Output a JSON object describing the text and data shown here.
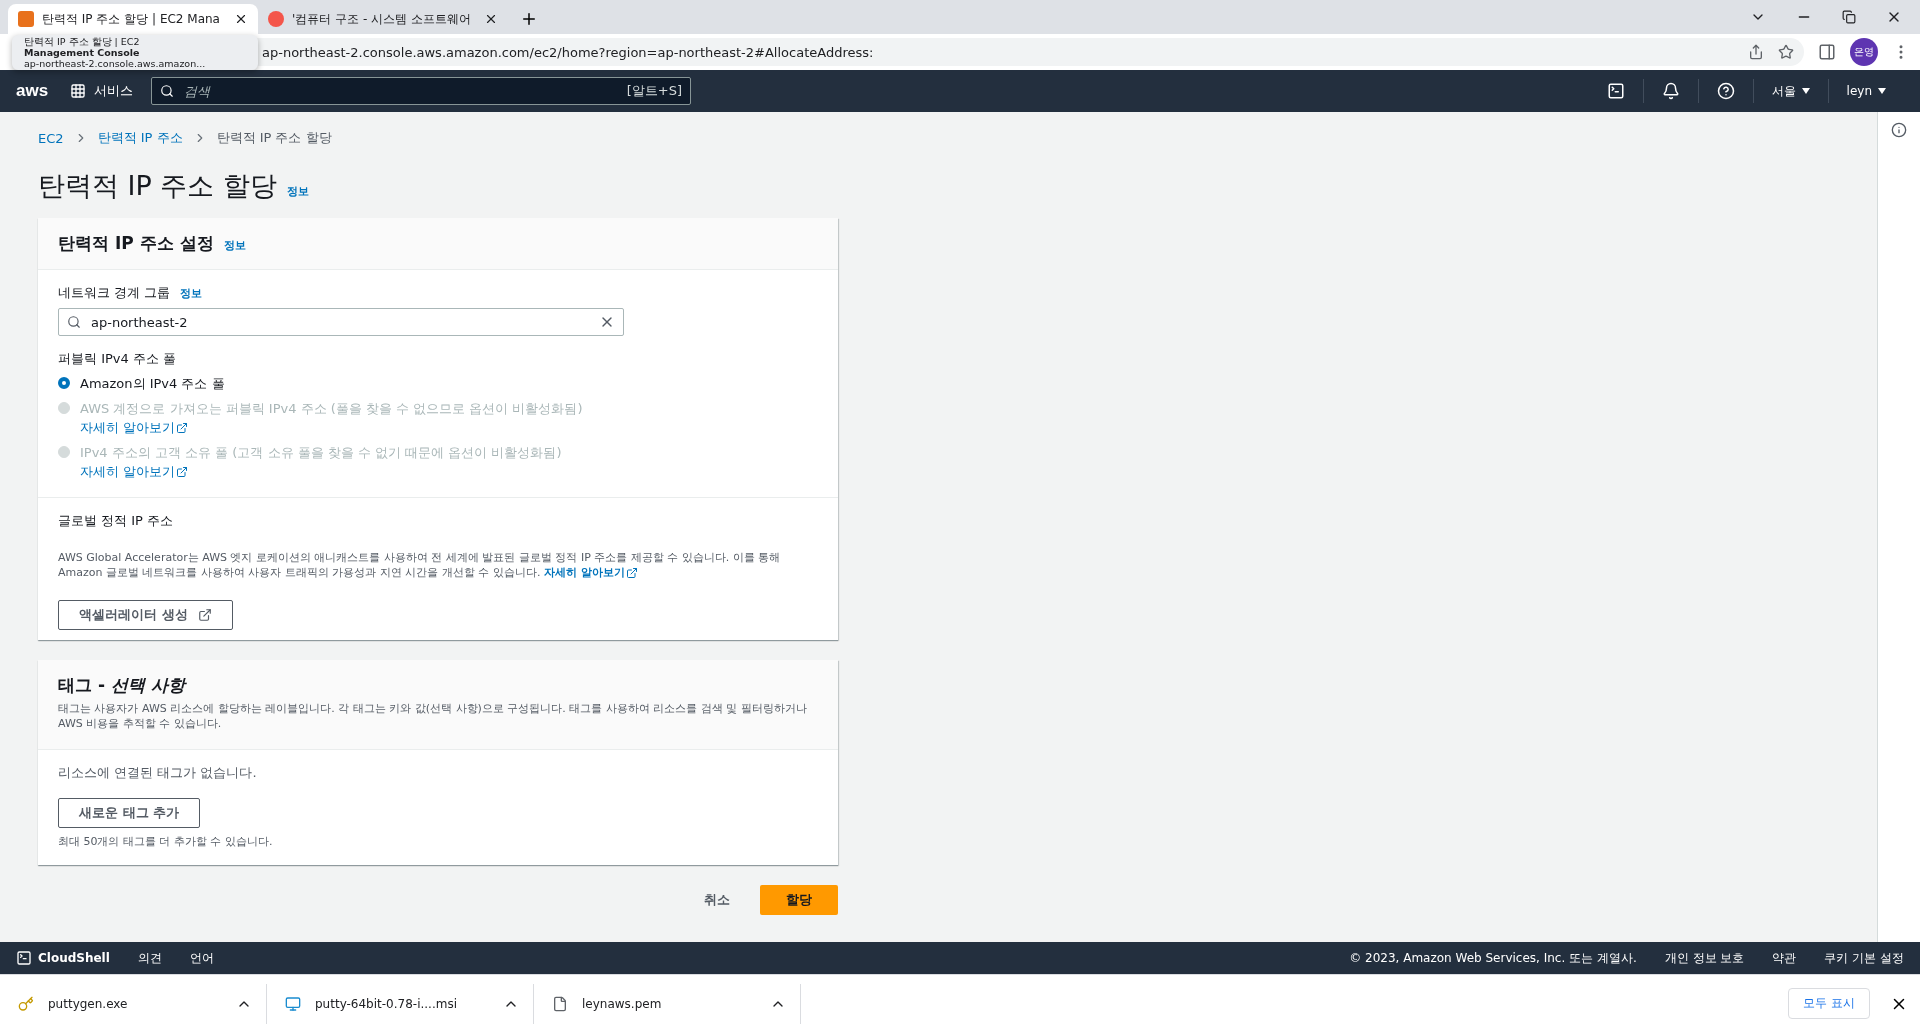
{
  "browser": {
    "tabs": [
      {
        "title": "탄력적 IP 주소 할당 | EC2 Mana",
        "kind": "console",
        "selected": true
      },
      {
        "title": "'컴퓨터 구조 - 시스템 소프트웨어",
        "kind": "blog",
        "selected": false
      }
    ],
    "url": "ap-northeast-2.console.aws.amazon.com/ec2/home?region=ap-northeast-2#AllocateAddress:",
    "profile": "은영"
  },
  "tab_preview": {
    "title": "탄력적 IP 주소 할당 | EC2",
    "subtitle": "Management Console",
    "url": "ap-northeast-2.console.aws.amazon..."
  },
  "nav": {
    "logo": "aws",
    "services": "서비스",
    "search_placeholder": "검색",
    "shortcut": "[알트+S]",
    "region": "서울",
    "user": "leyn"
  },
  "breadcrumb": [
    {
      "label": "EC2",
      "link": true
    },
    {
      "label": "탄력적 IP 주소",
      "link": true
    },
    {
      "label": "탄력적 IP 주소 할당",
      "link": false
    }
  ],
  "page": {
    "title": "탄력적 IP 주소 할당",
    "info": "정보"
  },
  "settings": {
    "title": "탄력적 IP 주소 설정",
    "info": "정보",
    "network_group": {
      "label": "네트워크 경계 그룹",
      "info": "정보",
      "value": "ap-northeast-2"
    },
    "pool": {
      "label": "퍼블릭 IPv4 주소 풀",
      "options": [
        {
          "label": "Amazon의 IPv4 주소 풀",
          "selected": true,
          "disabled": false
        },
        {
          "label": "AWS 계정으로 가져오는 퍼블릭 IPv4 주소 (풀을 찾을 수 없으므로 옵션이 비활성화됨)",
          "link": "자세히 알아보기",
          "selected": false,
          "disabled": true
        },
        {
          "label": "IPv4 주소의 고객 소유 풀 (고객 소유 풀을 찾을 수 없기 때문에 옵션이 비활성화됨)",
          "link": "자세히 알아보기",
          "selected": false,
          "disabled": true
        }
      ]
    },
    "global": {
      "label": "글로벌 정적 IP 주소",
      "description": "AWS Global Accelerator는 AWS 엣지 로케이션의 애니캐스트를 사용하여 전 세계에 발표된 글로벌 정적 IP 주소를 제공할 수 있습니다. 이를 통해 Amazon 글로벌 네트워크를 사용하여 사용자 트래픽의 가용성과 지연 시간을 개선할 수 있습니다.",
      "link": "자세히 알아보기",
      "button": "액셀러레이터 생성"
    }
  },
  "tags": {
    "title": "태그 - *선택 사항*",
    "description": "태그는 사용자가 AWS 리소스에 할당하는 레이블입니다. 각 태그는 키와 값(선택 사항)으로 구성됩니다. 태그를 사용하여 리소스를 검색 및 필터링하거나 AWS 비용을 추적할 수 있습니다.",
    "empty": "리소스에 연결된 태그가 없습니다.",
    "add_button": "새로운 태그 추가",
    "hint": "최대 50개의 태그를 더 추가할 수 있습니다."
  },
  "actions": {
    "cancel": "취소",
    "submit": "할당"
  },
  "footer": {
    "cloudshell": "CloudShell",
    "feedback": "의견",
    "language": "언어",
    "copyright": "© 2023, Amazon Web Services, Inc. 또는 계열사.",
    "links": [
      "개인 정보 보호",
      "약관",
      "쿠키 기본 설정"
    ]
  },
  "downloads": {
    "items": [
      {
        "name": "puttygen.exe",
        "kind": "key"
      },
      {
        "name": "putty-64bit-0.78-i....msi",
        "kind": "installer"
      },
      {
        "name": "leynaws.pem",
        "kind": "file"
      }
    ],
    "show_all": "모두 표시"
  }
}
